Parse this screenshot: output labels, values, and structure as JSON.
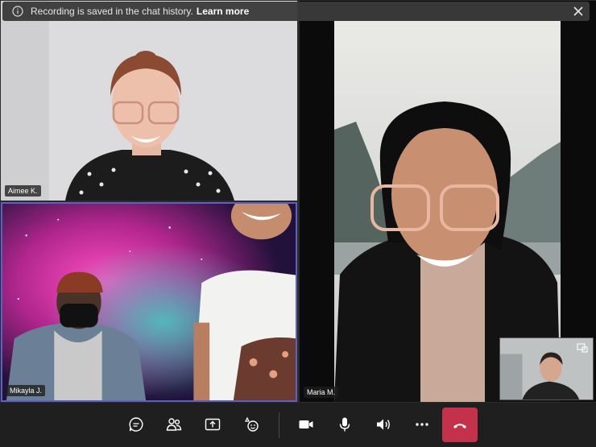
{
  "banner": {
    "message": "Recording is saved in the chat history.",
    "link": "Learn more"
  },
  "participants": {
    "aimee": "Aimee K.",
    "mikayla": "Mikayla J.",
    "maria": "Maria M."
  },
  "colors": {
    "hangup": "#c4314b",
    "active_speaker_border": "#5b5fc7",
    "toolbar_bg": "#1f1f1f"
  },
  "toolbar_icons": [
    "chat-icon",
    "people-icon",
    "share-screen-icon",
    "reactions-icon",
    "camera-icon",
    "microphone-icon",
    "speaker-icon",
    "more-options-icon",
    "hang-up-icon"
  ]
}
